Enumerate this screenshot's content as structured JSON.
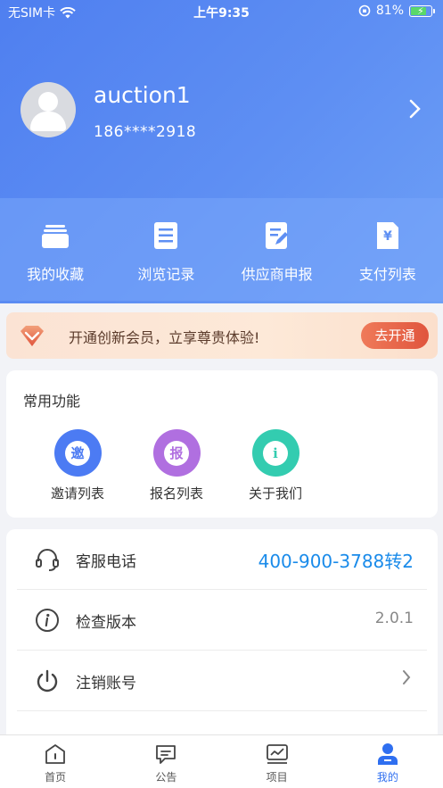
{
  "status_bar": {
    "carrier": "无SIM卡",
    "time": "上午9:35",
    "battery": "81%",
    "battery_level": 0.81
  },
  "profile": {
    "username": "auction1",
    "phone": "186****2918"
  },
  "quick_actions": [
    {
      "label": "我的收藏",
      "icon": "folder-icon"
    },
    {
      "label": "浏览记录",
      "icon": "list-doc-icon"
    },
    {
      "label": "供应商申报",
      "icon": "edit-doc-icon"
    },
    {
      "label": "支付列表",
      "icon": "yen-doc-icon"
    }
  ],
  "vip": {
    "text": "开通创新会员，立享尊贵体验!",
    "button": "去开通",
    "icon": "diamond-icon"
  },
  "common_functions": {
    "title": "常用功能",
    "items": [
      {
        "label": "邀请列表",
        "glyph": "邀",
        "color": "#4c7bf3"
      },
      {
        "label": "报名列表",
        "glyph": "报",
        "color": "#b06fe0"
      },
      {
        "label": "关于我们",
        "glyph": "i",
        "color": "#33ccb0"
      }
    ]
  },
  "settings": [
    {
      "label": "客服电话",
      "value": "400-900-3788转2",
      "icon": "headset-icon"
    },
    {
      "label": "检查版本",
      "value": "2.0.1",
      "icon": "info-icon"
    },
    {
      "label": "注销账号",
      "value": "",
      "icon": "power-icon"
    }
  ],
  "tabbar": [
    {
      "label": "首页",
      "icon": "home-icon",
      "active": false
    },
    {
      "label": "公告",
      "icon": "message-icon",
      "active": false
    },
    {
      "label": "项目",
      "icon": "chart-card-icon",
      "active": false
    },
    {
      "label": "我的",
      "icon": "user-icon",
      "active": true
    }
  ],
  "colors": {
    "primary": "#4f7ff0",
    "link": "#1a8bea",
    "vip_button": "#e0553d",
    "tab_active": "#2f6ff0"
  }
}
